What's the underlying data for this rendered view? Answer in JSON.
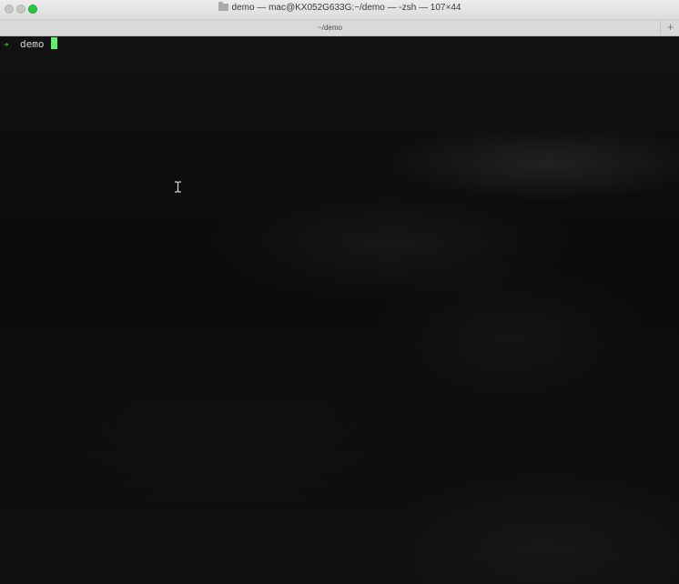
{
  "window": {
    "title": "demo — mac@KX052G633G:~/demo — -zsh — 107×44",
    "folder_icon": "folder-icon"
  },
  "tabbar": {
    "active_tab_label": "~/demo",
    "new_tab_label": "+"
  },
  "terminal": {
    "prompt_symbol": "➜",
    "prompt_dir": "demo",
    "cursor_color": "#5ef06a",
    "prompt_color": "#3fd34a"
  },
  "colors": {
    "traffic_close": "#c6c6c6",
    "traffic_minimize": "#c6c6c6",
    "traffic_zoom": "#2ac840"
  }
}
